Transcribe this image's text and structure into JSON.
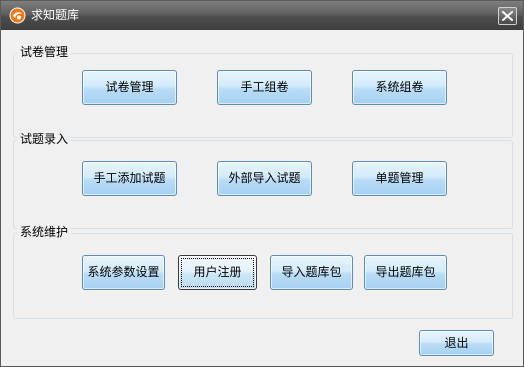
{
  "window": {
    "title": "求知题库",
    "close_symbol": "✕"
  },
  "groups": {
    "paper": {
      "title": "试卷管理",
      "buttons": [
        "试卷管理",
        "手工组卷",
        "系统组卷"
      ]
    },
    "question": {
      "title": "试题录入",
      "buttons": [
        "手工添加试题",
        "外部导入试题",
        "单题管理"
      ]
    },
    "system": {
      "title": "系统维护",
      "buttons": [
        "系统参数设置",
        "用户注册",
        "导入题库包",
        "导出题库包"
      ]
    }
  },
  "footer": {
    "exit_label": "退出"
  },
  "colors": {
    "titlebar": "#4d4d4d",
    "button_face": "#c9e5f9",
    "button_border": "#5f8cb4",
    "group_border": "#d5dfe5"
  },
  "icons": {
    "app": "app-logo-icon",
    "close": "close-icon"
  }
}
